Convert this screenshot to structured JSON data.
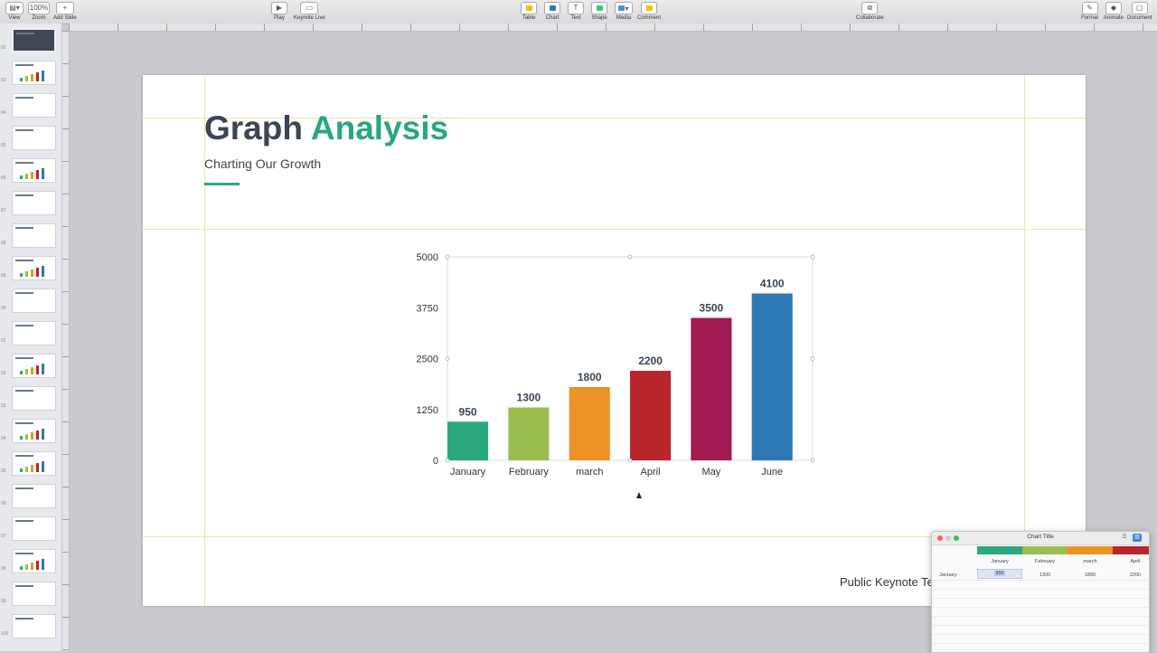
{
  "toolbar": {
    "view": "View",
    "zoom_value": "100%",
    "zoom": "Zoom",
    "add_slide": "Add Slide",
    "play": "Play",
    "keynote_live": "Keynote Live",
    "table": "Table",
    "chart": "Chart",
    "text": "Text",
    "shape": "Shape",
    "media": "Media",
    "comment": "Comment",
    "collaborate": "Collaborate",
    "format": "Format",
    "animate": "Animate",
    "document": "Document"
  },
  "navigator": {
    "slide_numbers": [
      "82",
      "83",
      "84",
      "85",
      "86",
      "87",
      "88",
      "89",
      "90",
      "91",
      "92",
      "93",
      "94",
      "95",
      "96",
      "97",
      "98",
      "99",
      "100"
    ]
  },
  "slide": {
    "title_part1": "Graph",
    "title_part2": "Analysis",
    "subtitle": "Charting Our Growth",
    "footer": "Public Keynote Te"
  },
  "chart_data": {
    "type": "bar",
    "categories": [
      "January",
      "February",
      "march",
      "April",
      "May",
      "June"
    ],
    "values": [
      950,
      1300,
      1800,
      2200,
      3500,
      4100
    ],
    "colors": [
      "#2aa77e",
      "#9bbd4e",
      "#ed9224",
      "#b8262c",
      "#a11a52",
      "#2f78b6"
    ],
    "y_ticks": [
      "5000",
      "3750",
      "2500",
      "1250",
      "0"
    ],
    "ylim": [
      0,
      5000
    ],
    "title": "",
    "xlabel": "",
    "ylabel": "",
    "grid": false,
    "data_labels": true
  },
  "editor": {
    "title": "Chart Title",
    "row_label": "January",
    "columns": [
      "January",
      "February",
      "march",
      "April"
    ],
    "values": [
      "950",
      "1300",
      "1800",
      "2200"
    ],
    "colors": [
      "#2aa77e",
      "#9bbd4e",
      "#ed9224",
      "#b8262c"
    ]
  }
}
